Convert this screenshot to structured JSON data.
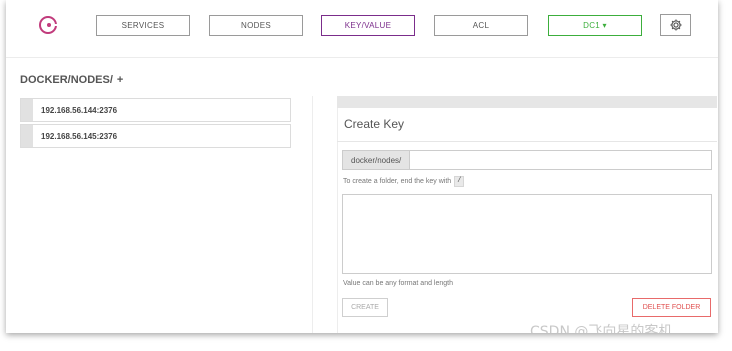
{
  "nav": {
    "services": "SERVICES",
    "nodes": "NODES",
    "key_value": "KEY/VALUE",
    "acl": "ACL",
    "datacenter": "DC1 ▾"
  },
  "icons": {
    "logo": "consul-logo-icon",
    "settings": "gear-icon"
  },
  "colors": {
    "active": "#7b2d8b",
    "datacenter": "#3cae3c",
    "danger": "#e0504f",
    "logo": "#c13b7c"
  },
  "breadcrumb": {
    "path": "DOCKER/NODES/",
    "add": "+"
  },
  "keys": [
    {
      "label": "192.168.56.144:2376"
    },
    {
      "label": "192.168.56.145:2376"
    }
  ],
  "create_key": {
    "title": "Create Key",
    "prefix": "docker/nodes/",
    "key_value": "",
    "hint_text": "To create a folder, end the key with",
    "hint_code": "/",
    "value": "",
    "value_hint": "Value can be any format and length",
    "create_label": "CREATE",
    "delete_label": "DELETE FOLDER"
  },
  "watermark": "CSDN @飞向星的客机"
}
